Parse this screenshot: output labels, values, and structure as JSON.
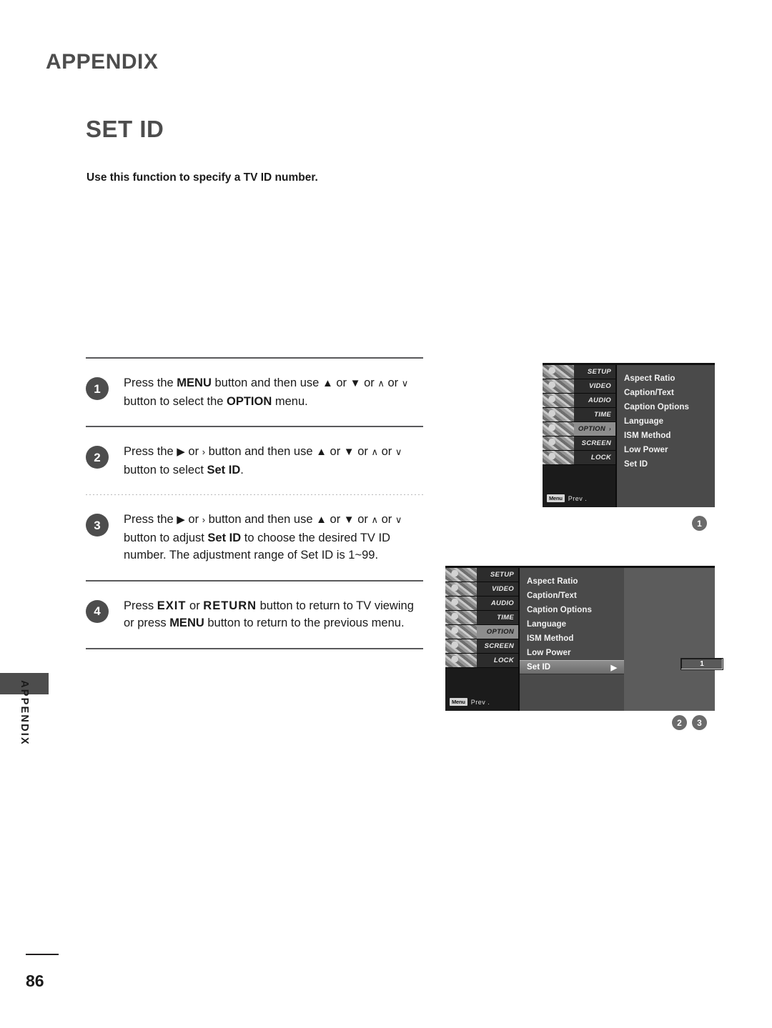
{
  "chapter": {
    "title": "APPENDIX"
  },
  "section": {
    "title": "SET ID",
    "subtitle": "Use this function to specify a TV ID number."
  },
  "steps": [
    {
      "number": "1",
      "text_parts": [
        "Press the ",
        "MENU",
        " button and then use ",
        "▲",
        " or ",
        "▼",
        " or ",
        "∧",
        " or ",
        "∨",
        " button to select the ",
        "OPTION",
        " menu."
      ]
    },
    {
      "number": "2",
      "text_parts": [
        "Press the ",
        "▶",
        " or ",
        "›",
        " button and then use ",
        "▲",
        " or ",
        "▼",
        " or ",
        "∧",
        " or ",
        "∨",
        " button to select ",
        "Set ID",
        "."
      ]
    },
    {
      "number": "3",
      "text_parts": [
        "Press the ",
        "▶",
        " or ",
        "›",
        " button and then use ",
        "▲",
        " or ",
        "▼",
        " or ",
        "∧",
        " or ",
        "∨",
        " button to adjust ",
        "Set ID",
        " to choose the desired TV ID number. The adjustment range of Set ID is 1~99."
      ]
    },
    {
      "number": "4",
      "text_parts": [
        "Press ",
        "EXIT",
        " or ",
        "RETURN",
        " button to return to TV viewing or press ",
        "MENU",
        " button to return to the previous menu."
      ]
    }
  ],
  "osd": {
    "categories": [
      "SETUP",
      "VIDEO",
      "AUDIO",
      "TIME",
      "OPTION",
      "SCREEN",
      "LOCK"
    ],
    "prev_key": "Menu",
    "prev_label": "Prev .",
    "items": [
      "Aspect Ratio",
      "Caption/Text",
      "Caption Options",
      "Language",
      "ISM Method",
      "Low Power",
      "Set ID"
    ],
    "menu_1": {
      "active_category": "OPTION",
      "category_arrow": "›",
      "selected_item": ""
    },
    "menu_2": {
      "active_category": "OPTION",
      "selected_item": "Set ID",
      "selected_arrow": "▶",
      "value": "1"
    }
  },
  "markers": {
    "m1": "1",
    "m2": "2",
    "m3": "3"
  },
  "sidebar": {
    "vertical_label": "APPENDIX"
  },
  "footer": {
    "page_number": "86"
  },
  "colors": {
    "heading_gray": "#4d4d4d",
    "body_black": "#1a1a1a",
    "osd_panel": "#5c5c5c",
    "osd_items_bg": "#4a4a4a",
    "badge_bg": "#4d4d4d",
    "marker_bg": "#6b6b6b"
  }
}
